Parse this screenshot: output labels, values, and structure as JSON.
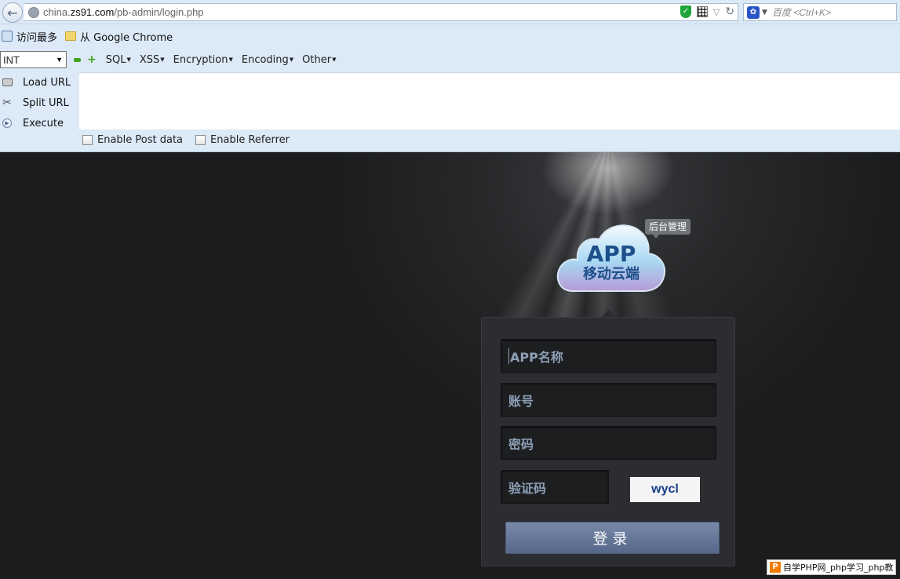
{
  "browser": {
    "url_prefix": "china.",
    "url_domain": "zs91.com",
    "url_path": "/pb-admin/login.php",
    "search_placeholder": "百度 <Ctrl+K>",
    "shield_glyph": "✓",
    "reload_glyph": "↻",
    "back_glyph": "←"
  },
  "bookmarks": [
    {
      "label": "访问最多",
      "icon": "most-visited-icon"
    },
    {
      "label": "从 Google Chrome",
      "icon": "folder-icon"
    }
  ],
  "hackbar": {
    "select_value": "INT",
    "menus": [
      "SQL",
      "XSS",
      "Encryption",
      "Encoding",
      "Other"
    ],
    "actions": [
      "Load URL",
      "Split URL",
      "Execute"
    ],
    "checkboxes": [
      "Enable Post data",
      "Enable Referrer"
    ]
  },
  "login": {
    "badge": "后台管理",
    "logo_title": "APP",
    "logo_subtitle": "移动云端",
    "app_name_placeholder": "APP名称",
    "account_placeholder": "账号",
    "password_placeholder": "密码",
    "captcha_placeholder": "验证码",
    "captcha_text": "wycl",
    "submit_label": "登录"
  },
  "watermark": {
    "logo_letter": "P",
    "text": "自学PHP网_php学习_php教"
  },
  "colors": {
    "chrome_bg": "#dce9f7",
    "page_bg": "#1b1c1e",
    "button": "#6677a0",
    "field_text": "#8da0b6"
  }
}
